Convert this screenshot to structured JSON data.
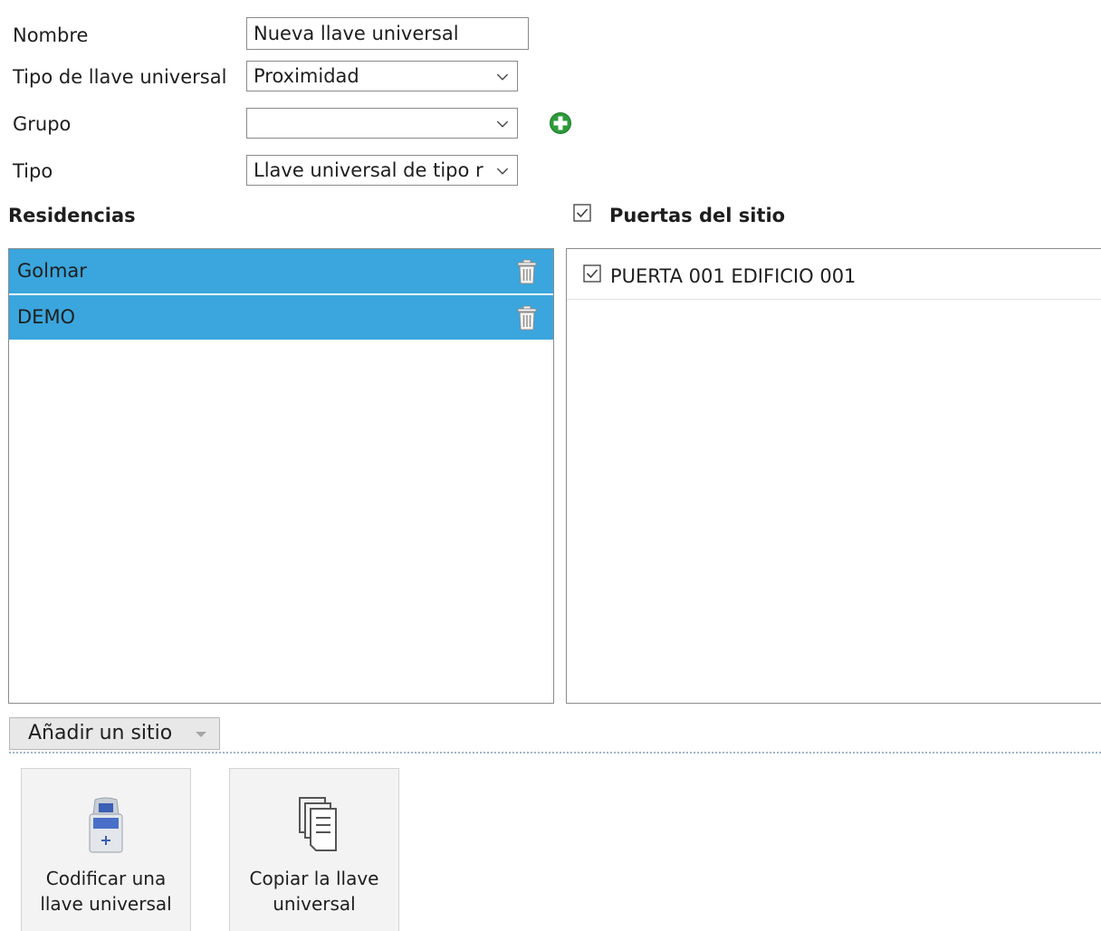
{
  "form": {
    "nombre_label": "Nombre",
    "nombre_value": "Nueva llave universal",
    "tipo_llave_label": "Tipo de llave universal",
    "tipo_llave_value": "Proximidad",
    "grupo_label": "Grupo",
    "grupo_value": "",
    "tipo_label": "Tipo",
    "tipo_value": "Llave universal de tipo r"
  },
  "residencias": {
    "title": "Residencias",
    "items": [
      {
        "name": "Golmar"
      },
      {
        "name": "DEMO"
      }
    ]
  },
  "puertas": {
    "title": "Puertas del sitio",
    "all_checked": true,
    "items": [
      {
        "name": "PUERTA 001 EDIFICIO 001",
        "checked": true
      }
    ]
  },
  "add_site_label": "Añadir un sitio",
  "actions": {
    "encode_line1": "Codificar una",
    "encode_line2": "llave universal",
    "copy_line1": "Copiar la llave",
    "copy_line2": "universal"
  },
  "icons": {
    "add": "plus-circle-icon",
    "trash": "trash-icon",
    "encoder": "encoder-device-icon",
    "copy": "copy-documents-icon"
  },
  "colors": {
    "selected_row": "#3aa6dd",
    "add_green": "#2e9a3a"
  }
}
